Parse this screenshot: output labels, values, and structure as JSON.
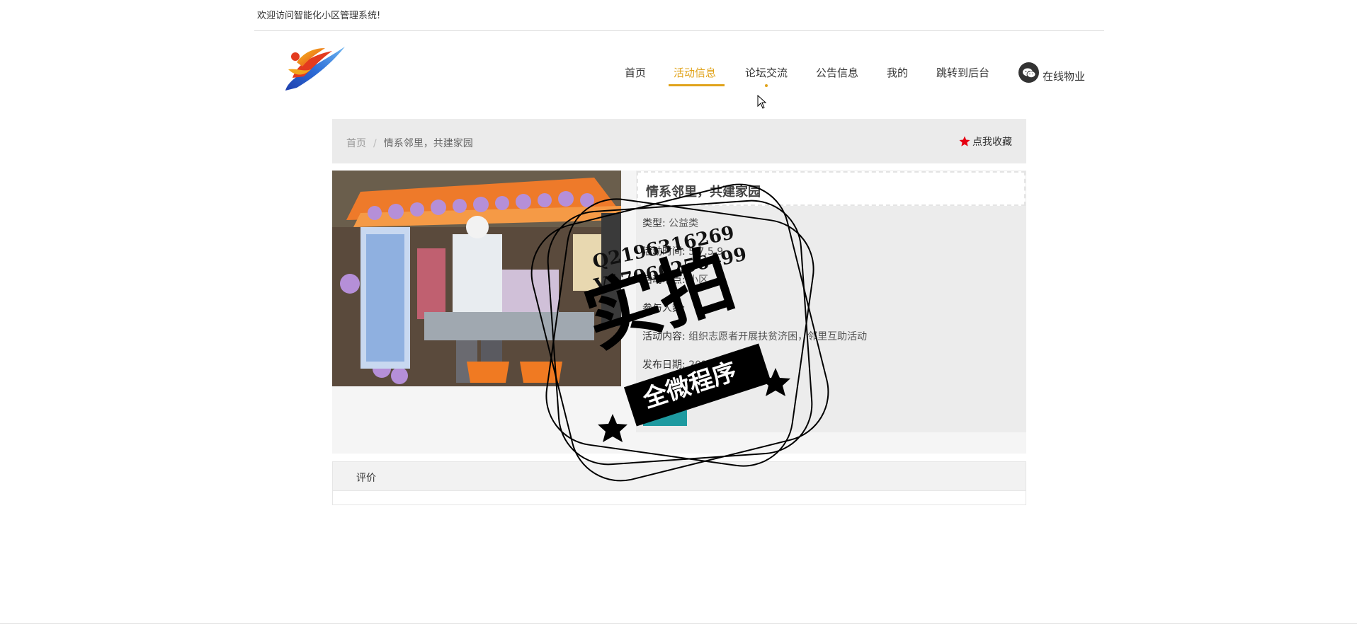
{
  "header": {
    "welcome": "欢迎访问智能化小区管理系统!"
  },
  "nav": {
    "items": [
      "首页",
      "活动信息",
      "论坛交流",
      "公告信息",
      "我的",
      "跳转到后台"
    ],
    "active_index": 1,
    "online_service": "在线物业"
  },
  "breadcrumb": {
    "home": "首页",
    "separator": "/",
    "current": "情系邻里，共建家园"
  },
  "favorite": {
    "label": "点我收藏",
    "icon": "star-icon"
  },
  "activity": {
    "title": "情系邻里，共建家园",
    "fields": [
      {
        "label": "类型:",
        "value": "公益类"
      },
      {
        "label": "活动时间:",
        "value": "5.7.5.9"
      },
      {
        "label": "活动地点:",
        "value": "小区"
      },
      {
        "label": "参与人数:",
        "value": ""
      },
      {
        "label": "活动内容:",
        "value": "组织志愿者开展扶贫济困，邻里互助活动"
      },
      {
        "label": "发布日期:",
        "value": "2021-03-09"
      }
    ]
  },
  "review": {
    "title": "评价"
  },
  "watermark": {
    "qq": "Q2196316269",
    "vx": "V17060256499",
    "big": "实拍",
    "banner": "全微程序"
  },
  "colors": {
    "accent": "#e0a31b",
    "teal": "#1e9aa0",
    "panel": "#ececec"
  }
}
